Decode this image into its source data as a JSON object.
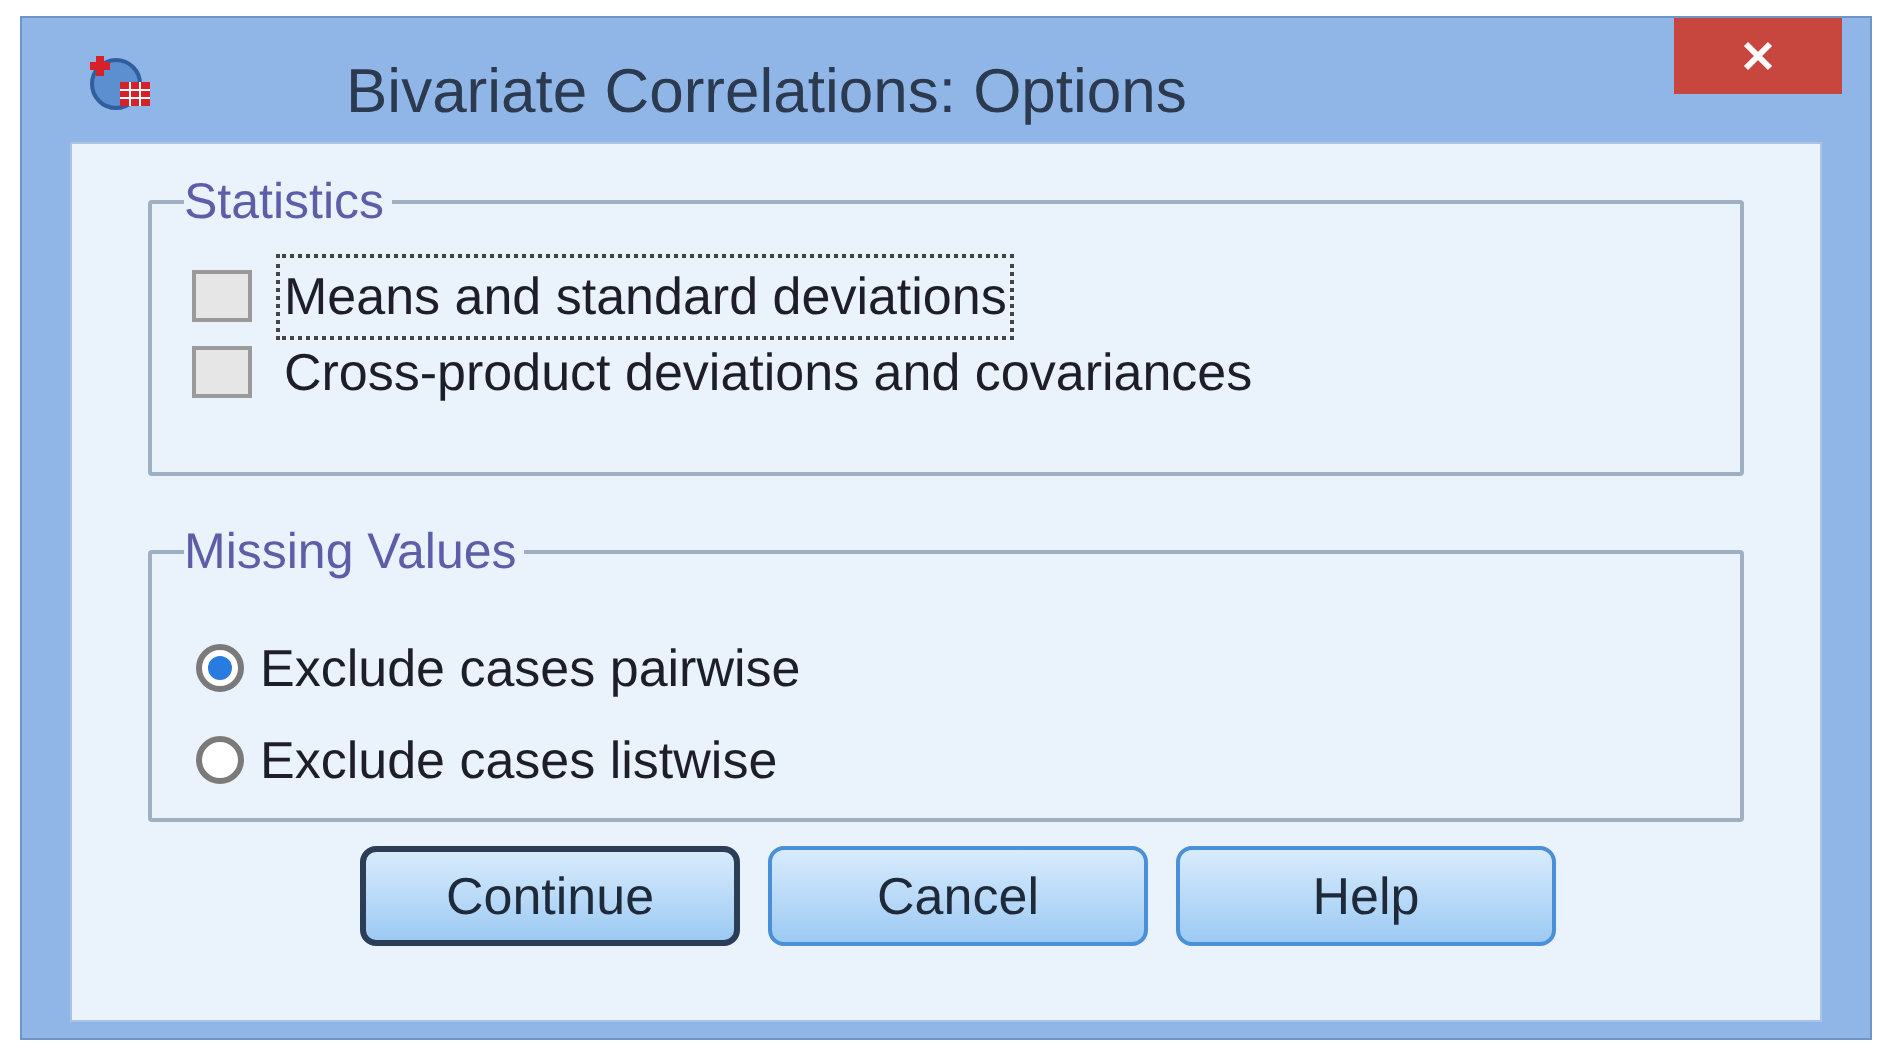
{
  "window": {
    "title": "Bivariate Correlations: Options"
  },
  "statistics": {
    "title": "Statistics",
    "options": [
      {
        "label": "Means and standard deviations",
        "checked": false,
        "focused": true
      },
      {
        "label": "Cross-product deviations and covariances",
        "checked": false,
        "focused": false
      }
    ]
  },
  "missing_values": {
    "title": "Missing Values",
    "options": [
      {
        "label": "Exclude cases pairwise",
        "selected": true
      },
      {
        "label": "Exclude cases listwise",
        "selected": false
      }
    ]
  },
  "buttons": [
    {
      "label": "Continue",
      "default": true
    },
    {
      "label": "Cancel",
      "default": false
    },
    {
      "label": "Help",
      "default": false
    }
  ]
}
